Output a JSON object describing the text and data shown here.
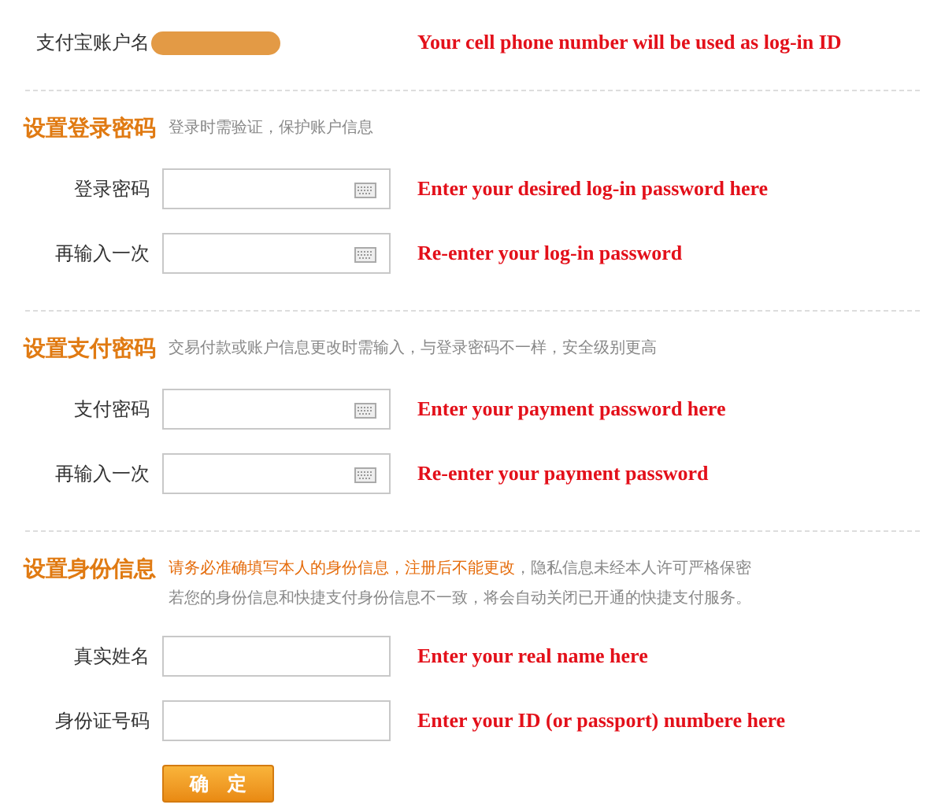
{
  "account": {
    "label": "支付宝账户名",
    "value_redacted": true,
    "note": "Your cell phone number will be used as log-in ID"
  },
  "sections": [
    {
      "title": "设置登录密码",
      "hint_lines": [
        [
          {
            "text": "登录时需验证，保护账户信息",
            "emphasized": false
          }
        ]
      ],
      "fields": [
        {
          "label": "登录密码",
          "kind": "password",
          "note": "Enter your desired log-in password here"
        },
        {
          "label": "再输入一次",
          "kind": "password",
          "note": "Re-enter your log-in password"
        }
      ]
    },
    {
      "title": "设置支付密码",
      "hint_lines": [
        [
          {
            "text": "交易付款或账户信息更改时需输入，与登录密码不一样，安全级别更高",
            "emphasized": false
          }
        ]
      ],
      "fields": [
        {
          "label": "支付密码",
          "kind": "password",
          "note": "Enter your payment password here"
        },
        {
          "label": "再输入一次",
          "kind": "password",
          "note": "Re-enter your payment password"
        }
      ]
    },
    {
      "title": "设置身份信息",
      "hint_lines": [
        [
          {
            "text": "请务必准确填写本人的身份信息，注册后不能更改",
            "emphasized": true
          },
          {
            "text": "，隐私信息未经本人许可严格保密",
            "emphasized": false
          }
        ],
        [
          {
            "text": "若您的身份信息和快捷支付身份信息不一致，将会自动关闭已开通的快捷支付服务。",
            "emphasized": false
          }
        ]
      ],
      "fields": [
        {
          "label": "真实姓名",
          "kind": "text",
          "note": "Enter your real name here"
        },
        {
          "label": "身份证号码",
          "kind": "text",
          "note": "Enter your ID (or passport) numbere here"
        }
      ]
    }
  ],
  "submit": {
    "label": "确　定"
  }
}
